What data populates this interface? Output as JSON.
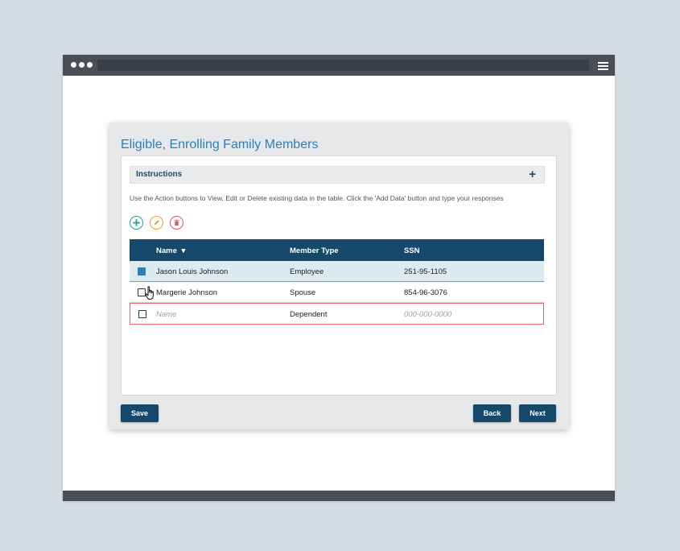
{
  "page": {
    "title": "Eligible, Enrolling Family Members"
  },
  "instructions": {
    "label": "Instructions",
    "expand_glyph": "+",
    "help_text": "Use the Action buttons to View, Edit or Delete existing data in the table. Click the 'Add Data' button and type your responses"
  },
  "actions": {
    "add_icon": "plus-icon",
    "edit_icon": "pencil-icon",
    "delete_icon": "trash-icon",
    "add_color": "#2a9f8f",
    "edit_color": "#e7a13c",
    "delete_color": "#e05b5b"
  },
  "table": {
    "columns": [
      "Name",
      "Member Type",
      "SSN"
    ],
    "sort_glyph": "▾",
    "rows": [
      {
        "name": "Jason Louis Johnson",
        "type": "Employee",
        "ssn": "251-95-1105",
        "checked": true
      },
      {
        "name": "Margerie Johnson",
        "type": "Spouse",
        "ssn": "854-96-3076",
        "checked": false
      }
    ],
    "new_row": {
      "name_placeholder": "Name",
      "type": "Dependent",
      "ssn_placeholder": "000-000-0000"
    }
  },
  "footer": {
    "save_label": "Save",
    "back_label": "Back",
    "next_label": "Next"
  },
  "colors": {
    "header_bg": "#16486b",
    "title": "#2b7fb8",
    "selected_row": "#dceaf1",
    "invalid_border": "#e36b6b"
  }
}
